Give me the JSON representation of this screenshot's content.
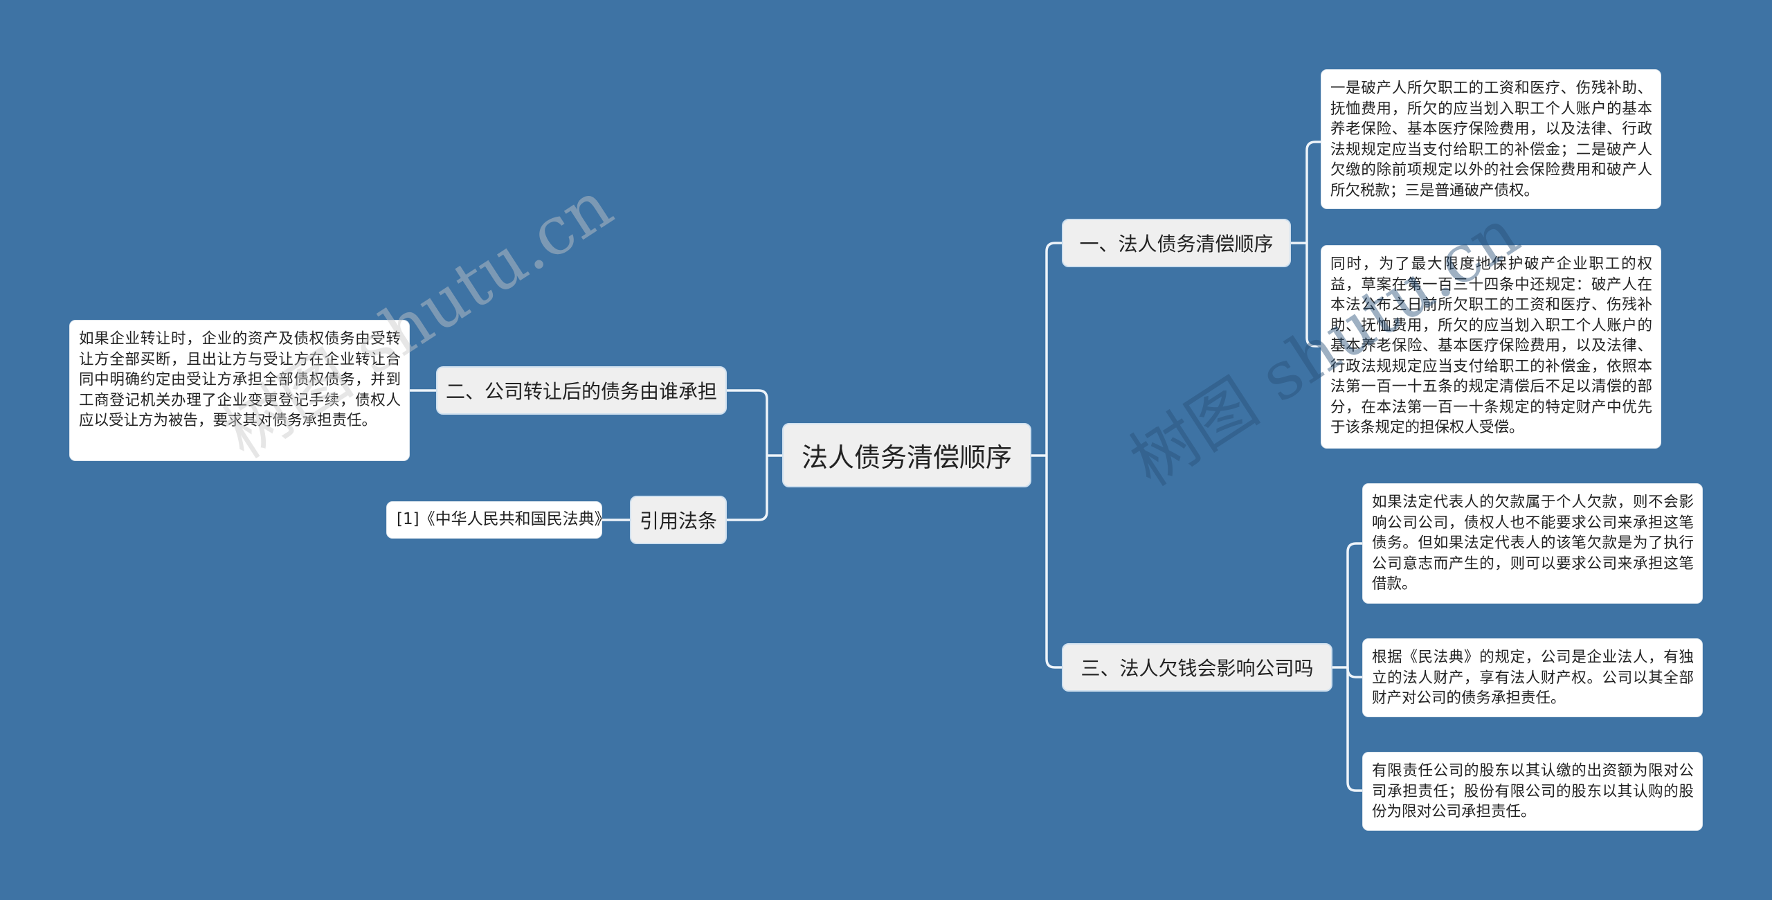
{
  "colors": {
    "background": "#3e73a4",
    "topic_fill": "#efefef",
    "leaf_fill": "#ffffff",
    "connector": "#eef4fa",
    "text": "#222222"
  },
  "watermarks": [
    "树图 shutu.cn",
    "树图 shutu.cn"
  ],
  "root": {
    "label": "法人债务清偿顺序"
  },
  "right_topics": [
    {
      "label": "一、法人债务清偿顺序",
      "children": [
        "一是破产人所欠职工的工资和医疗、伤残补助、抚恤费用，所欠的应当划入职工个人账户的基本养老保险、基本医疗保险费用，以及法律、行政法规规定应当支付给职工的补偿金；二是破产人欠缴的除前项规定以外的社会保险费用和破产人所欠税款；三是普通破产债权。",
        "同时，为了最大限度地保护破产企业职工的权益，草案在第一百三十四条中还规定：破产人在本法公布之日前所欠职工的工资和医疗、伤残补助、抚恤费用，所欠的应当划入职工个人账户的基本养老保险、基本医疗保险费用，以及法律、行政法规规定应当支付给职工的补偿金，依照本法第一百一十五条的规定清偿后不足以清偿的部分，在本法第一百一十条规定的特定财产中优先于该条规定的担保权人受偿。"
      ]
    },
    {
      "label": "三、法人欠钱会影响公司吗",
      "children": [
        "如果法定代表人的欠款属于个人欠款，则不会影响公司公司，债权人也不能要求公司来承担这笔债务。但如果法定代表人的该笔欠款是为了执行公司意志而产生的，则可以要求公司来承担这笔借款。",
        "根据《民法典》的规定，公司是企业法人，有独立的法人财产，享有法人财产权。公司以其全部财产对公司的债务承担责任。",
        "有限责任公司的股东以其认缴的出资额为限对公司承担责任；股份有限公司的股东以其认购的股份为限对公司承担责任。"
      ]
    }
  ],
  "left_topics": [
    {
      "label": "二、公司转让后的债务由谁承担",
      "children": [
        "如果企业转让时，企业的资产及债权债务由受转让方全部买断，且出让方与受让方在企业转让合同中明确约定由受让方承担全部债权债务，并到工商登记机关办理了企业变更登记手续，债权人应以受让方为被告，要求其对债务承担责任。"
      ]
    },
    {
      "label": "引用法条",
      "children": [
        "[1]《中华人民共和国民法典》"
      ]
    }
  ]
}
